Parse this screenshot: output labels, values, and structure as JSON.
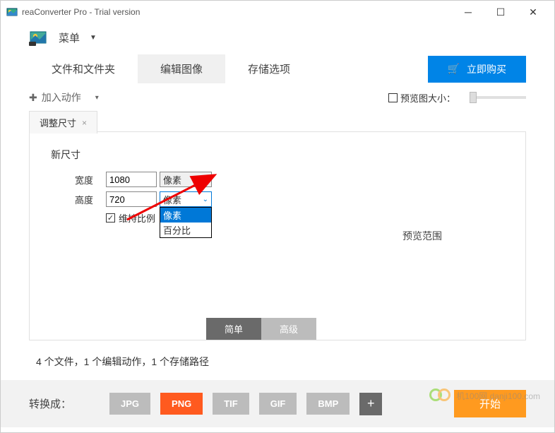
{
  "window": {
    "title": "reaConverter Pro - Trial version"
  },
  "menu": {
    "label": "菜单"
  },
  "tabs": {
    "files": "文件和文件夹",
    "edit": "编辑图像",
    "save": "存储选项",
    "buy": "立即购买"
  },
  "actionsBar": {
    "add": "加入动作",
    "previewSize": "预览图大小："
  },
  "resizePanel": {
    "tabTitle": "调整尺寸",
    "section": "新尺寸",
    "widthLabel": "宽度",
    "widthValue": "1080",
    "widthUnit": "像素",
    "heightLabel": "高度",
    "heightValue": "720",
    "heightUnit": "像素",
    "unitOptions": {
      "pixels": "像素",
      "percent": "百分比"
    },
    "keepRatio": "维持比例",
    "previewArea": "预览范围",
    "modeSimple": "简单",
    "modeAdvanced": "高级"
  },
  "status": "4 个文件，1 个编辑动作，1 个存储路径",
  "footer": {
    "convertTo": "转换成：",
    "formats": {
      "jpg": "JPG",
      "png": "PNG",
      "tif": "TIF",
      "gif": "GIF",
      "bmp": "BMP"
    },
    "start": "开始"
  },
  "watermark": "机100网 danji100.com"
}
